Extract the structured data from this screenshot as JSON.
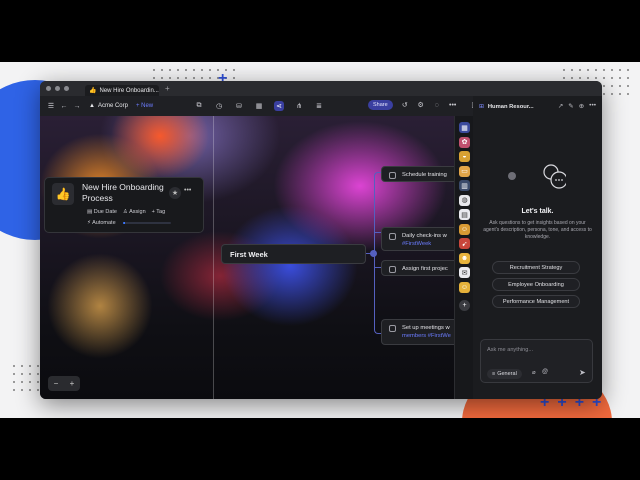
{
  "colors": {
    "accent": "#6c7cff",
    "share_bg": "#3a3fa0",
    "window_bg": "#1b1c1f",
    "backdrop_blue": "#2f63e6",
    "backdrop_orange": "#f26a3d"
  },
  "browser": {
    "tab_title": "New Hire Onboardin...",
    "tab_icon": "thumbs-up-icon",
    "new_tab": "+"
  },
  "toolbar": {
    "workspace": "Acme Corp",
    "new_label": "New",
    "share_label": "Share"
  },
  "task": {
    "title": "New Hire Onboarding Process",
    "icon": "thumbs-up-icon",
    "actions": {
      "due_date": "Due Date",
      "assign": "Assign",
      "tag": "Tag",
      "automate": "Automate"
    },
    "progress": 0.04
  },
  "mindmap": {
    "main_node": "First Week",
    "sub_nodes": [
      {
        "line1": "Schedule training",
        "line2": ""
      },
      {
        "line1": "Daily check-ins w",
        "line2": "#FirstWeek"
      },
      {
        "line1": "Assign first projec",
        "line2": ""
      },
      {
        "line1": "Set up meetings w",
        "line2": "members #FirstWe"
      }
    ]
  },
  "zoom": {
    "minus": "−",
    "plus": "+"
  },
  "panel": {
    "title": "Human Resour...",
    "heading": "Let's talk.",
    "description": "Ask questions to get insights based on your agent's description, persona, tone, and access to knowledge.",
    "suggestions": [
      "Recruitment Strategy",
      "Employee Onboarding",
      "Performance Management"
    ],
    "input_placeholder": "Ask me anything...",
    "mode_label": "General"
  },
  "rail_icons": [
    "grid-icon",
    "brain-icon",
    "hotdog-icon",
    "folder-icon",
    "chart-icon",
    "chat-icon",
    "inbox-icon",
    "face-icon",
    "rocket-icon",
    "smile-icon",
    "mail-icon",
    "emoji-icon",
    "add-icon"
  ]
}
